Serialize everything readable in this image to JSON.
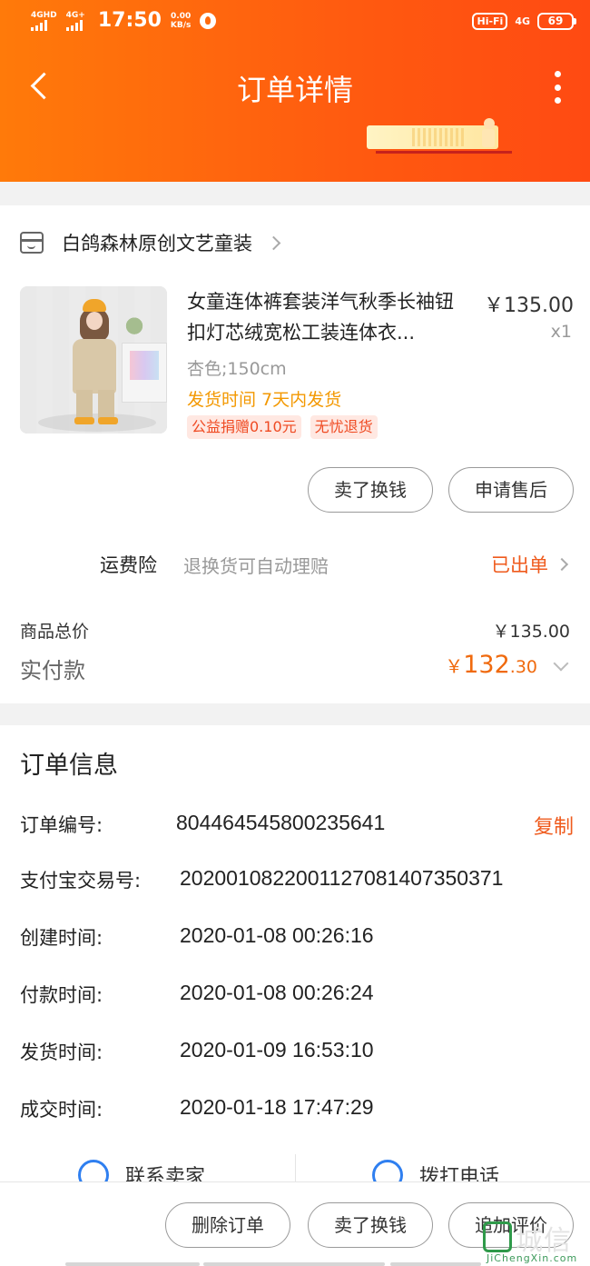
{
  "status_bar": {
    "sig1_label": "4GHD",
    "sig2_label": "4G+",
    "time": "17:50",
    "speed_top": "0.00",
    "speed_unit": "KB/s",
    "hifi": "Hi-Fi",
    "net_right": "4G",
    "battery": "69"
  },
  "nav": {
    "title": "订单详情"
  },
  "shop": {
    "name": "白鸽森林原创文艺童装"
  },
  "product": {
    "title": "女童连体裤套装洋气秋季长袖钮扣灯芯绒宽松工装连体衣...",
    "price": "￥135.00",
    "qty": "x1",
    "sku": "杏色;150cm",
    "shipping": "发货时间 7天内发货",
    "tags": [
      "公益捐赠0.10元",
      "无忧退货"
    ]
  },
  "actions": {
    "sell": "卖了换钱",
    "after_sale": "申请售后"
  },
  "insurance": {
    "label": "运费险",
    "desc": "退换货可自动理赔",
    "status": "已出单"
  },
  "totals": {
    "total_label": "商品总价",
    "total_value": "￥135.00",
    "paid_label": "实付款",
    "paid_currency": "￥",
    "paid_int": "132",
    "paid_dec": ".30"
  },
  "order_info": {
    "title": "订单信息",
    "copy": "复制",
    "rows": [
      {
        "key": "订单编号:",
        "value": "804464545800235641"
      },
      {
        "key": "支付宝交易号:",
        "value": "2020010822001127081407350371"
      },
      {
        "key": "创建时间:",
        "value": "2020-01-08 00:26:16"
      },
      {
        "key": "付款时间:",
        "value": "2020-01-08 00:26:24"
      },
      {
        "key": "发货时间:",
        "value": "2020-01-09 16:53:10"
      },
      {
        "key": "成交时间:",
        "value": "2020-01-18 17:47:29"
      }
    ]
  },
  "contact": {
    "chat": "联系卖家",
    "call": "拨打电话"
  },
  "bottom": {
    "delete": "删除订单",
    "sell": "卖了换钱",
    "review": "追加评价"
  },
  "watermark": {
    "title": "城信",
    "sub": "JiChengXin.com"
  },
  "colors": {
    "accent": "#ff5a10",
    "price": "#f06a0e",
    "warn": "#f39800"
  }
}
